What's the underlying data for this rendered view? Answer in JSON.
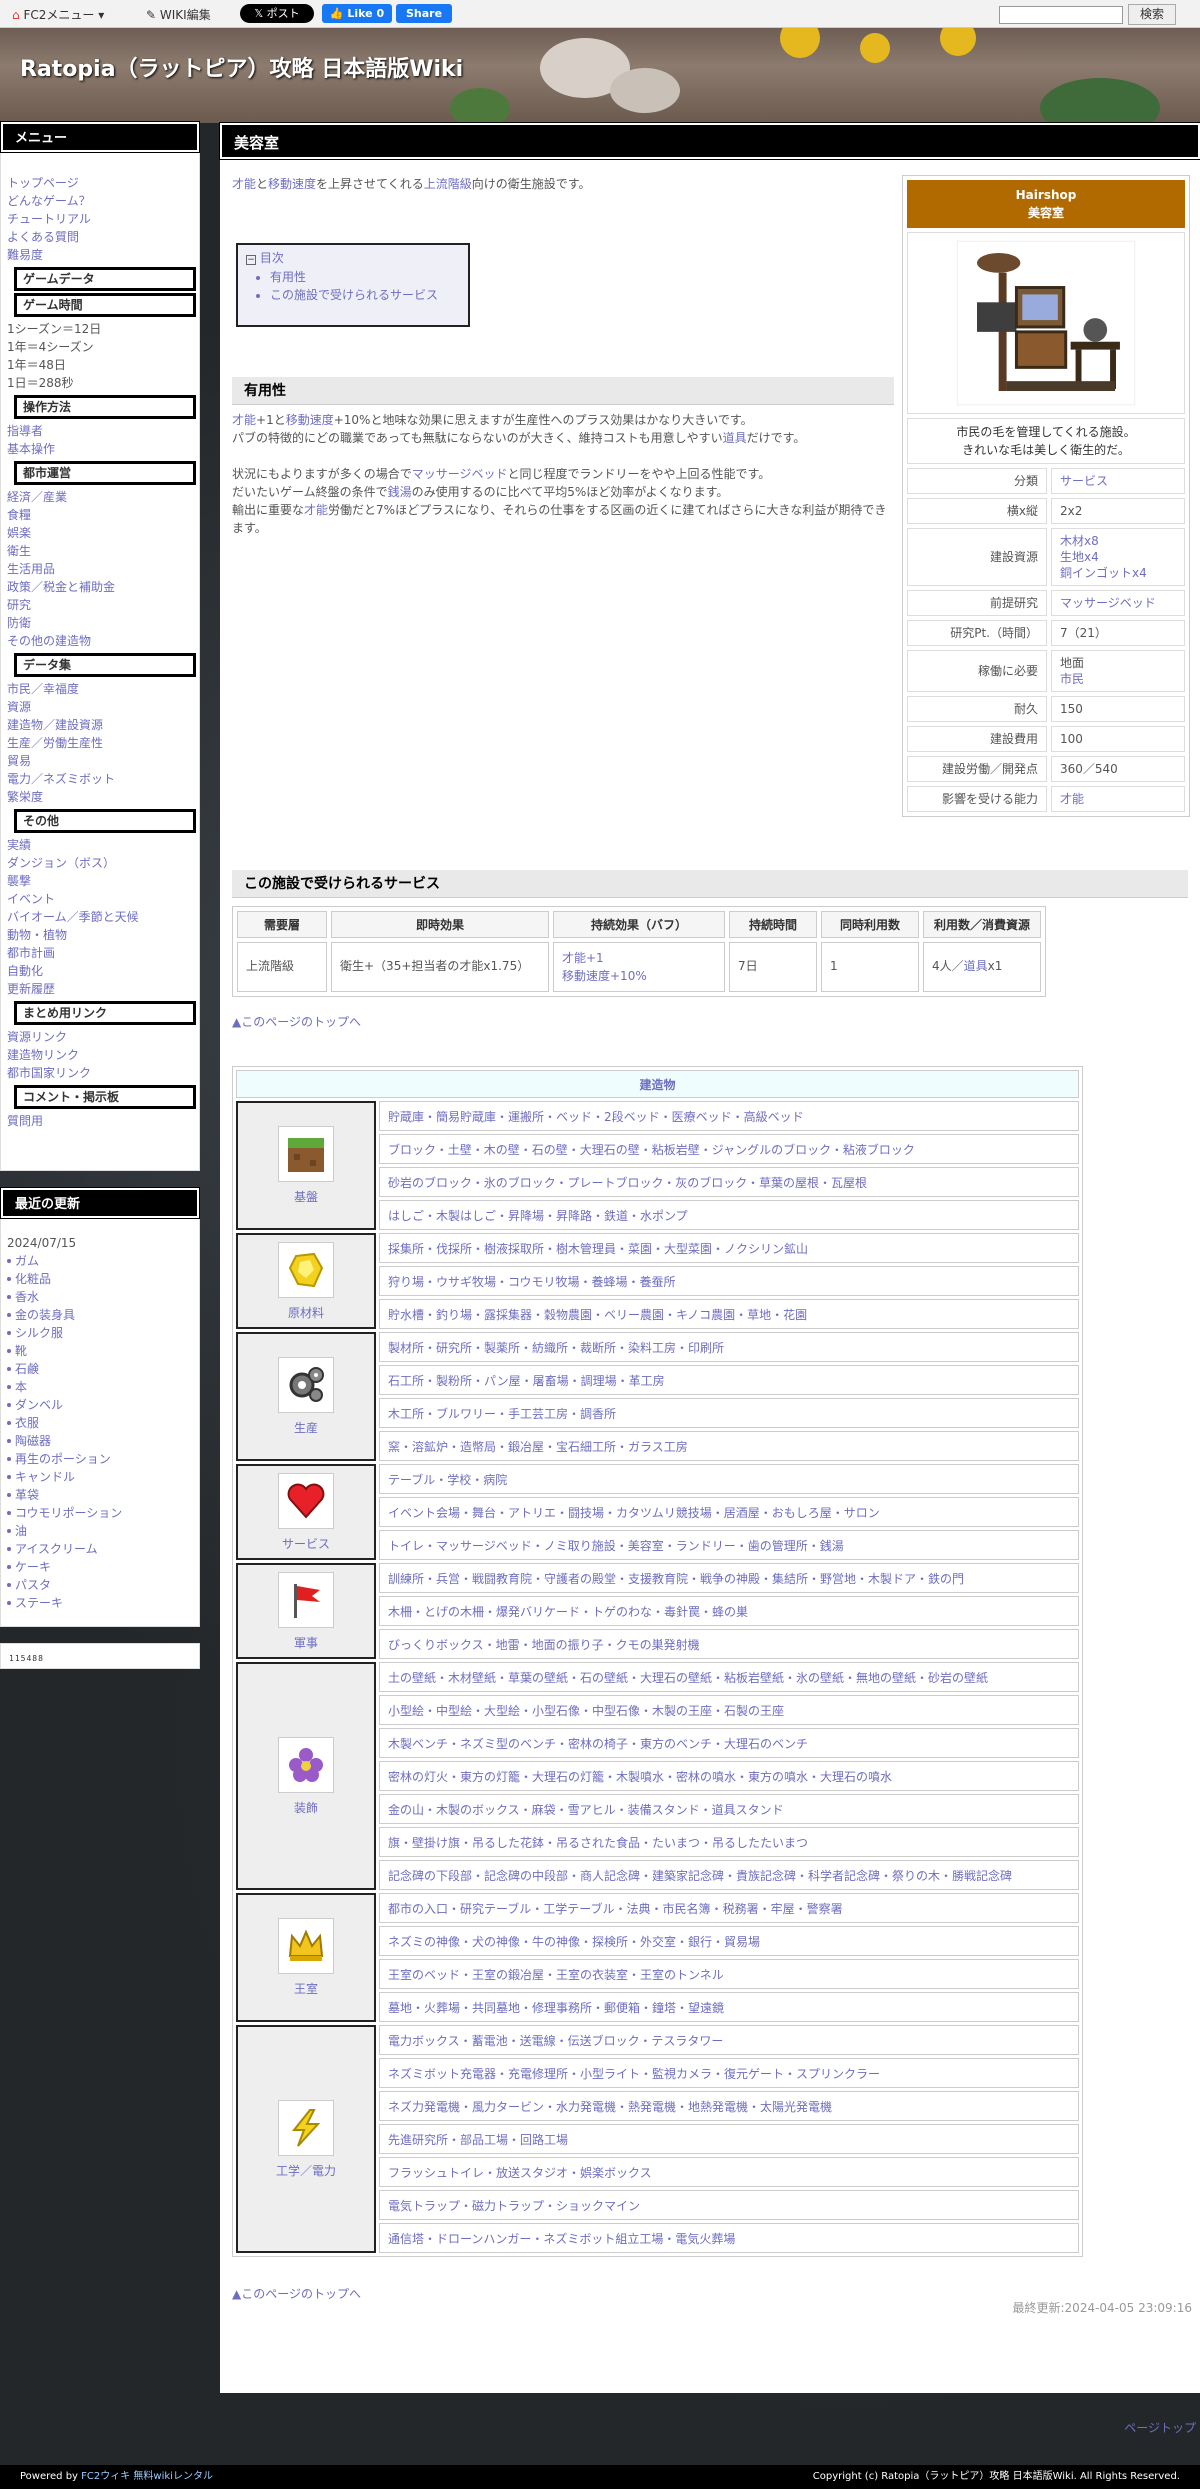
{
  "topbar": {
    "fc2_menu": "FC2メニュー",
    "wiki_edit": "WIKI編集",
    "x_post": "𝕏 ポスト",
    "fb_like": "👍 Like 0",
    "fb_share": "Share",
    "search_button": "検索"
  },
  "site_title": "Ratopia（ラットピア）攻略 日本語版Wiki",
  "menu": {
    "title": "メニュー",
    "links1": [
      "トップページ",
      "どんなゲーム？",
      "チュートリアル",
      "よくある質問",
      "難易度"
    ],
    "game_data": "ゲームデータ",
    "game_time": "ゲーム時間",
    "time_lines": [
      "1シーズン＝12日",
      "1年＝4シーズン",
      "1年＝48日",
      "1日＝288秒"
    ],
    "controls": "操作方法",
    "control_links": [
      "指導者",
      "基本操作"
    ],
    "city": "都市運営",
    "city_links": [
      "経済／産業",
      "食糧",
      "娯楽",
      "衛生",
      "生活用品",
      "政策／税金と補助金",
      "研究",
      "防衛",
      "その他の建造物"
    ],
    "data_col": "データ集",
    "data_links": [
      "市民／幸福度",
      "資源",
      "建造物／建設資源",
      "生産／労働生産性",
      "貿易",
      "電力／ネズミボット",
      "繁栄度"
    ],
    "other": "その他",
    "other_links": [
      "実績",
      "ダンジョン（ボス）",
      "襲撃",
      "イベント",
      "バイオーム／季節と天候",
      "動物・植物",
      "都市計画",
      "自動化",
      "更新履歴"
    ],
    "summary": "まとめ用リンク",
    "summary_links": [
      "資源リンク",
      "建造物リンク",
      "都市国家リンク"
    ],
    "comment": "コメント・掲示板",
    "comment_links": [
      "質問用"
    ]
  },
  "recent": {
    "title": "最近の更新",
    "date": "2024/07/15",
    "items": [
      "ガム",
      "化粧品",
      "香水",
      "金の装身具",
      "シルク服",
      "靴",
      "石鹸",
      "本",
      "ダンベル",
      "衣服",
      "陶磁器",
      "再生のポーション",
      "キャンドル",
      "革袋",
      "コウモリポーション",
      "油",
      "アイスクリーム",
      "ケーキ",
      "パスタ",
      "ステーキ"
    ]
  },
  "counter": "115488",
  "page": {
    "title": "美容室",
    "intro": {
      "l1": "才能",
      "t1": "と",
      "l2": "移動速度",
      "t2": "を上昇させてくれる",
      "l3": "上流階級",
      "t3": "向けの衛生施設です。"
    },
    "toc": {
      "label": "目次",
      "items": [
        "有用性",
        "この施設で受けられるサービス"
      ]
    },
    "useful": {
      "heading": "有用性",
      "p1a": "才能",
      "p1b": "+1と",
      "p1c": "移動速度",
      "p1d": "+10%と地味な効果に思えますが生産性へのプラス効果はかなり大きいです。",
      "p2a": "パブの特徴的にどの職業であっても無駄にならないのが大きく、維持コストも用意しやすい",
      "p2b": "道具",
      "p2c": "だけです。",
      "p3a": "状況にもよりますが多くの場合で",
      "p3b": "マッサージベッド",
      "p3c": "と同じ程度でランドリーをやや上回る性能です。",
      "p4a": "だいたいゲーム終盤の条件で",
      "p4b": "銭湯",
      "p4c": "のみ使用するのに比べて平均5%ほど効率がよくなります。",
      "p5a": "輸出に重要な",
      "p5b": "才能",
      "p5c": "労働だと7%ほどプラスになり、それらの仕事をする区画の近くに建てればさらに大きな利益が期待できます。"
    },
    "services_heading": "この施設で受けられるサービス",
    "services_table": {
      "headers": [
        "需要層",
        "即時効果",
        "持続効果（バフ）",
        "持続時間",
        "同時利用数",
        "利用数／消費資源"
      ],
      "row": {
        "c1": "上流階級",
        "c2": "衛生+（35+担当者の才能x1.75）",
        "c3a": "才能+1",
        "c3b": "移動速度+10%",
        "c4": "7日",
        "c5": "1",
        "c6a": "4人／",
        "c6b": "道具",
        "c6c": "x1"
      }
    },
    "to_top": "▲このページのトップへ",
    "last_modified": "最終更新:2024-04-05 23:09:16"
  },
  "infobox": {
    "name_en": "Hairshop",
    "name_ja": "美容室",
    "desc1": "市民の毛を管理してくれる施設。",
    "desc2": "きれいな毛は美しく衛生的だ。",
    "rows": [
      {
        "k": "分類",
        "v": [
          "サービス"
        ]
      },
      {
        "k": "横x縦",
        "v": [
          "2x2"
        ]
      },
      {
        "k": "建設資源",
        "v": [
          "木材x8",
          "生地x4",
          "銅インゴットx4"
        ]
      },
      {
        "k": "前提研究",
        "v": [
          "マッサージベッド"
        ]
      },
      {
        "k": "研究Pt.（時間）",
        "v": [
          "7（21）"
        ]
      },
      {
        "k": "稼働に必要",
        "v": [
          "地面",
          "市民"
        ]
      },
      {
        "k": "耐久",
        "v": [
          "150"
        ]
      },
      {
        "k": "建設費用",
        "v": [
          "100"
        ]
      },
      {
        "k": "建設労働／開発点",
        "v": [
          "360／540"
        ]
      },
      {
        "k": "影響を受ける能力",
        "v": [
          "才能"
        ]
      }
    ]
  },
  "buildings": {
    "heading": "建造物",
    "categories": [
      {
        "name": "基盤",
        "icon": "dirt-block-icon",
        "rows": [
          "貯蔵庫・簡易貯蔵庫・運搬所・ベッド・2段ベッド・医療ベッド・高級ベッド",
          "ブロック・土壁・木の壁・石の壁・大理石の壁・粘板岩壁・ジャングルのブロック・粘液ブロック",
          "砂岩のブロック・氷のブロック・プレートブロック・灰のブロック・草葉の屋根・瓦屋根",
          "はしご・木製はしご・昇降場・昇降路・鉄道・水ポンプ"
        ]
      },
      {
        "name": "原材料",
        "icon": "ore-icon",
        "rows": [
          "採集所・伐採所・樹液採取所・樹木管理員・菜園・大型菜園・ノクシリン鉱山",
          "狩り場・ウサギ牧場・コウモリ牧場・養蜂場・養蚕所",
          "貯水槽・釣り場・露採集器・穀物農園・ベリー農園・キノコ農園・草地・花園"
        ]
      },
      {
        "name": "生産",
        "icon": "gear-icon",
        "rows": [
          "製材所・研究所・製薬所・紡織所・裁断所・染料工房・印刷所",
          "石工所・製粉所・パン屋・屠畜場・調理場・革工房",
          "木工所・ブルワリー・手工芸工房・調香所",
          "窯・溶鉱炉・造幣局・鍛冶屋・宝石細工所・ガラス工房"
        ]
      },
      {
        "name": "サービス",
        "icon": "heart-icon",
        "rows": [
          "テーブル・学校・病院",
          "イベント会場・舞台・アトリエ・闘技場・カタツムリ競技場・居酒屋・おもしろ屋・サロン",
          "トイレ・マッサージベッド・ノミ取り施設・美容室・ランドリー・歯の管理所・銭湯"
        ]
      },
      {
        "name": "軍事",
        "icon": "flag-icon",
        "rows": [
          "訓練所・兵営・戦闘教育院・守護者の殿堂・支援教育院・戦争の神殿・集結所・野営地・木製ドア・鉄の門",
          "木柵・とげの木柵・爆発バリケード・トゲのわな・毒針罠・蜂の巣",
          "びっくりボックス・地雷・地面の振り子・クモの巣発射機"
        ]
      },
      {
        "name": "装飾",
        "icon": "flower-icon",
        "rows": [
          "土の壁紙・木材壁紙・草葉の壁紙・石の壁紙・大理石の壁紙・粘板岩壁紙・氷の壁紙・無地の壁紙・砂岩の壁紙",
          "小型絵・中型絵・大型絵・小型石像・中型石像・木製の王座・石製の王座",
          "木製ベンチ・ネズミ型のベンチ・密林の椅子・東方のベンチ・大理石のベンチ",
          "密林の灯火・東方の灯籠・大理石の灯籠・木製噴水・密林の噴水・東方の噴水・大理石の噴水",
          "金の山・木製のボックス・麻袋・雪アヒル・装備スタンド・道具スタンド",
          "旗・壁掛け旗・吊るした花鉢・吊るされた食品・たいまつ・吊るしたたいまつ",
          "記念碑の下段部・記念碑の中段部・商人記念碑・建築家記念碑・貴族記念碑・科学者記念碑・祭りの木・勝戦記念碑"
        ]
      },
      {
        "name": "王室",
        "icon": "crown-icon",
        "rows": [
          "都市の入口・研究テーブル・工学テーブル・法典・市民名簿・税務署・牢屋・警察署",
          "ネズミの神像・犬の神像・牛の神像・探検所・外交室・銀行・貿易場",
          "王室のベッド・王室の鍛冶屋・王室の衣装室・王室のトンネル",
          "墓地・火葬場・共同墓地・修理事務所・郵便箱・鐘塔・望遠鏡"
        ]
      },
      {
        "name": "工学／電力",
        "icon": "lightning-icon",
        "rows": [
          "電力ボックス・蓄電池・送電線・伝送ブロック・テスラタワー",
          "ネズミボット充電器・充電修理所・小型ライト・監視カメラ・復元ゲート・スプリンクラー",
          "ネズ力発電機・風力タービン・水力発電機・熱発電機・地熱発電機・太陽光発電機",
          "先進研究所・部品工場・回路工場",
          "フラッシュトイレ・放送スタジオ・娯楽ボックス",
          "電気トラップ・磁力トラップ・ショックマイン",
          "通信塔・ドローンハンガー・ネズミボット組立工場・電気火葬場"
        ]
      }
    ]
  },
  "page_top": "ページトップ",
  "footer": {
    "left_prefix": "Powered by ",
    "left_link": "FC2ウィキ 無料wikiレンタル",
    "right": "Copyright (c) Ratopia（ラットピア）攻略 日本語版Wiki. All Rights Reserved."
  }
}
